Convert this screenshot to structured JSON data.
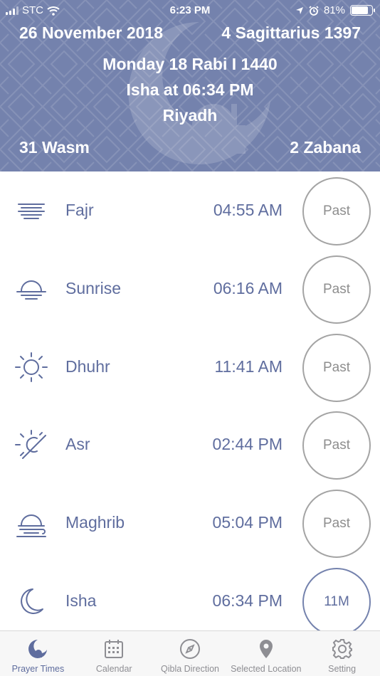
{
  "status_bar": {
    "carrier": "STC",
    "time": "6:23 PM",
    "battery": "81%",
    "battery_level": 0.81
  },
  "header": {
    "gregorian_date": "26 November 2018",
    "zodiac_date": "4 Sagittarius 1397",
    "hijri_date": "Monday 18 Rabi I 1440",
    "next_prayer": "Isha at 06:34 PM",
    "city": "Riyadh",
    "season_left": "31 Wasm",
    "season_right": "2 Zabana",
    "background_color": "#7482ad"
  },
  "prayers": [
    {
      "name": "Fajr",
      "time": "04:55 AM",
      "status": "Past",
      "icon": "fog-icon"
    },
    {
      "name": "Sunrise",
      "time": "06:16 AM",
      "status": "Past",
      "icon": "sunrise-icon"
    },
    {
      "name": "Dhuhr",
      "time": "11:41 AM",
      "status": "Past",
      "icon": "sun-icon"
    },
    {
      "name": "Asr",
      "time": "02:44 PM",
      "status": "Past",
      "icon": "partial-sun-icon"
    },
    {
      "name": "Maghrib",
      "time": "05:04 PM",
      "status": "Past",
      "icon": "sunset-icon"
    },
    {
      "name": "Isha",
      "time": "06:34 PM",
      "status": "11M",
      "icon": "moon-icon"
    }
  ],
  "tabs": [
    {
      "label": "Prayer Times",
      "icon": "crescent-mosque-icon",
      "active": true
    },
    {
      "label": "Calendar",
      "icon": "calendar-icon",
      "active": false
    },
    {
      "label": "Qibla Direction",
      "icon": "compass-icon",
      "active": false
    },
    {
      "label": "Selected Location",
      "icon": "location-pin-icon",
      "active": false
    },
    {
      "label": "Setting",
      "icon": "gear-icon",
      "active": false
    }
  ],
  "colors": {
    "accent": "#5f6d9e",
    "header": "#7482ad",
    "past_ring": "#a4a4a4"
  }
}
